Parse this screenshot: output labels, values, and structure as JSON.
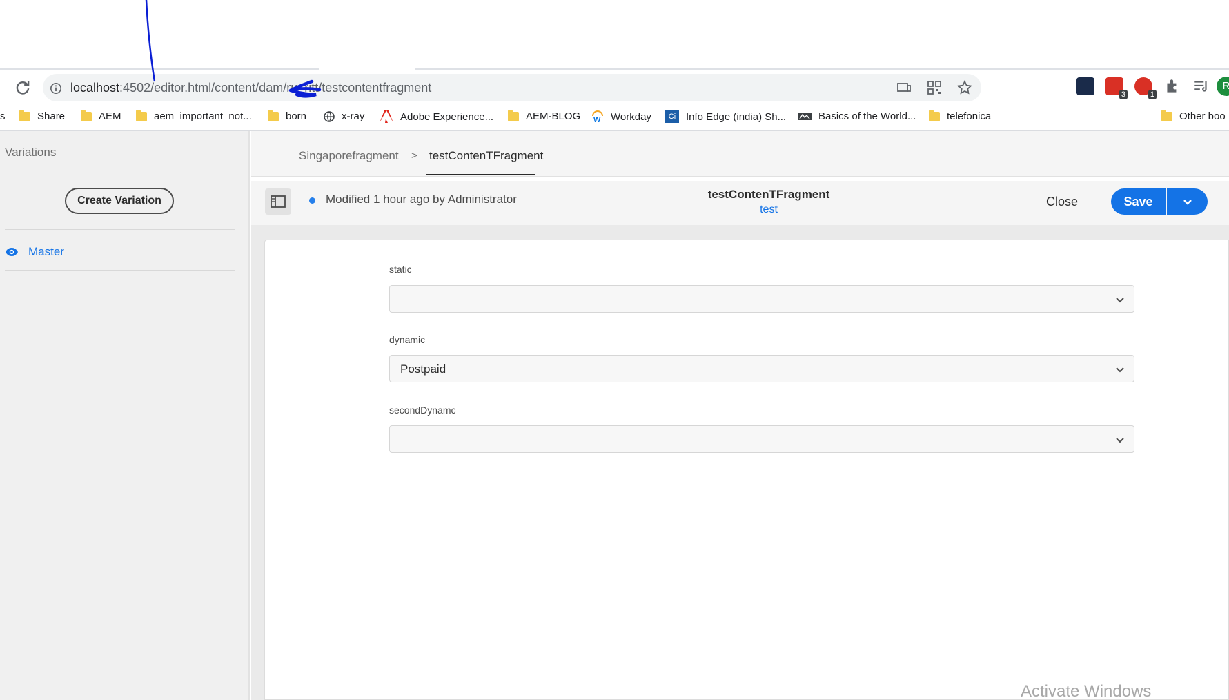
{
  "browser": {
    "url_host": "localhost",
    "url_rest": ":4502/editor.html/content/dam/",
    "url_scribble": "ru_ritt",
    "url_tail": "/testcontentfragment",
    "extension_badges": [
      "3",
      "1"
    ],
    "profile_initial": "R"
  },
  "bookmarks": {
    "partial_left": "s",
    "items": [
      "Share",
      "AEM",
      "aem_important_not...",
      "born",
      "x-ray",
      "Adobe Experience...",
      "AEM-BLOG",
      "Workday",
      "Info Edge (india) Sh...",
      "Basics of the World...",
      "telefonica"
    ],
    "other": "Other boo"
  },
  "rail": {
    "title": "Variations",
    "create_label": "Create Variation",
    "master_label": "Master"
  },
  "breadcrumb": {
    "parent": "Singaporefragment",
    "separator": ">",
    "current": "testContenTFragment"
  },
  "editor": {
    "status": "Modified 1 hour ago by Administrator",
    "title": "testContenTFragment",
    "model": "test",
    "close_label": "Close",
    "save_label": "Save"
  },
  "form": {
    "fields": [
      {
        "label": "static",
        "value": ""
      },
      {
        "label": "dynamic",
        "value": "Postpaid"
      },
      {
        "label": "secondDynamc",
        "value": ""
      }
    ]
  },
  "watermark": "Activate Windows",
  "colors": {
    "accent": "#1473e6",
    "annotation": "#0b1fd4",
    "profile": "#1e8e3e"
  }
}
